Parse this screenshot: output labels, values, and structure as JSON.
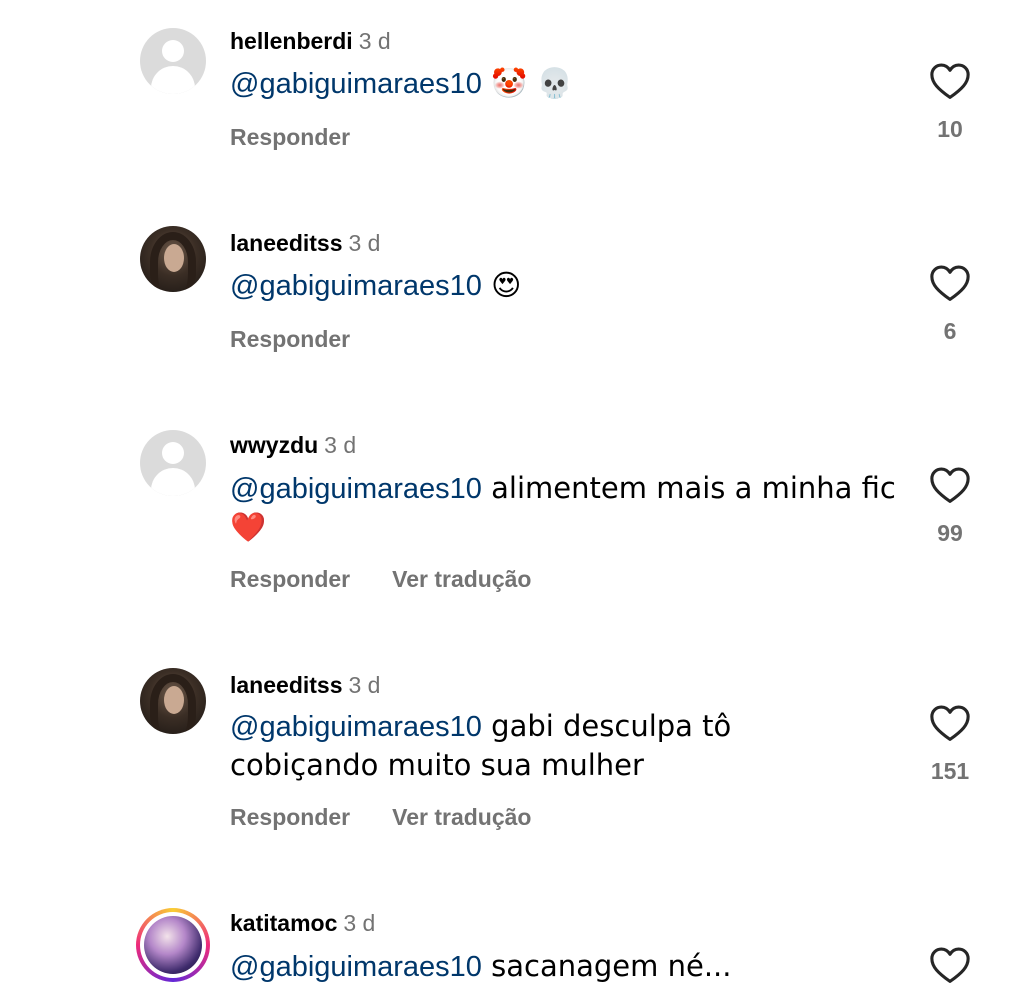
{
  "comments": [
    {
      "username": "hellenberdi",
      "time": "3 d",
      "avatar": "default-avatar",
      "mention": "@gabiguimaraes10",
      "text": " 🤡 💀",
      "reply_label": "Responder",
      "translate_label": "",
      "likes": "10"
    },
    {
      "username": "laneeditss",
      "time": "3 d",
      "avatar": "photo-avatar",
      "mention": "@gabiguimaraes10",
      "text": " 😍",
      "reply_label": "Responder",
      "translate_label": "",
      "likes": "6"
    },
    {
      "username": "wwyzdu",
      "time": "3 d",
      "avatar": "default-avatar",
      "mention": "@gabiguimaraes10",
      "text": " alimentem mais a minha fic❤️",
      "reply_label": "Responder",
      "translate_label": "Ver tradução",
      "likes": "99"
    },
    {
      "username": "laneeditss",
      "time": "3 d",
      "avatar": "photo-avatar",
      "mention": "@gabiguimaraes10",
      "text": " gabi desculpa tô cobiçando muito sua mulher",
      "reply_label": "Responder",
      "translate_label": "Ver tradução",
      "likes": "151"
    },
    {
      "username": "katitamoc",
      "time": "3 d",
      "avatar": "story-ring-avatar",
      "mention": "@gabiguimaraes10",
      "text": " sacanagem né...",
      "reply_label": "",
      "translate_label": "",
      "likes": ""
    }
  ],
  "icons": {
    "like": "heart-outline-icon"
  },
  "colors": {
    "mention": "#00376b",
    "secondary_text": "#737373",
    "heart_stroke": "#262626",
    "default_avatar": "#dbdbdb"
  }
}
